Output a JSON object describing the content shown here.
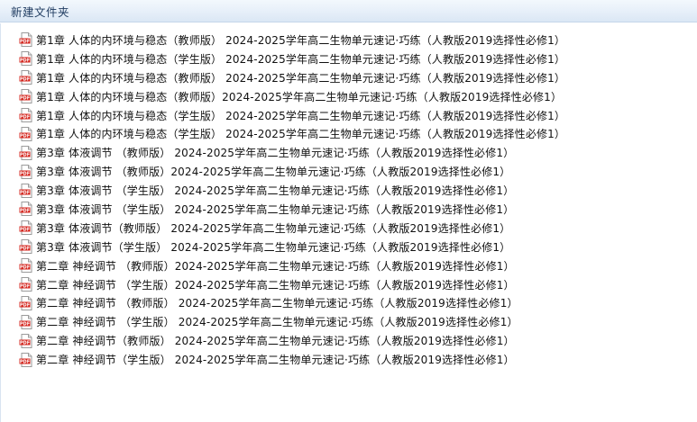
{
  "window": {
    "title": "新建文件夹"
  },
  "files": [
    {
      "name": "第1章 人体的内环境与稳态（教师版） 2024-2025学年高二生物单元速记·巧练（人教版2019选择性必修1）",
      "icon": "pdf-icon"
    },
    {
      "name": "第1章 人体的内环境与稳态（学生版） 2024-2025学年高二生物单元速记·巧练（人教版2019选择性必修1）",
      "icon": "pdf-icon"
    },
    {
      "name": "第1章 人体的内环境与稳态（教师版） 2024-2025学年高二生物单元速记·巧练（人教版2019选择性必修1）",
      "icon": "pdf-icon"
    },
    {
      "name": "第1章 人体的内环境与稳态（教师版）2024-2025学年高二生物单元速记·巧练（人教版2019选择性必修1）",
      "icon": "pdf-icon"
    },
    {
      "name": "第1章 人体的内环境与稳态（学生版） 2024-2025学年高二生物单元速记·巧练（人教版2019选择性必修1）",
      "icon": "pdf-icon"
    },
    {
      "name": "第1章 人体的内环境与稳态（学生版） 2024-2025学年高二生物单元速记·巧练（人教版2019选择性必修1）",
      "icon": "pdf-icon"
    },
    {
      "name": "第3章 体液调节 （教师版） 2024-2025学年高二生物单元速记·巧练（人教版2019选择性必修1）",
      "icon": "pdf-icon"
    },
    {
      "name": "第3章 体液调节 （教师版）2024-2025学年高二生物单元速记·巧练（人教版2019选择性必修1）",
      "icon": "pdf-icon"
    },
    {
      "name": "第3章 体液调节 （学生版） 2024-2025学年高二生物单元速记·巧练（人教版2019选择性必修1）",
      "icon": "pdf-icon"
    },
    {
      "name": "第3章 体液调节 （学生版） 2024-2025学年高二生物单元速记·巧练（人教版2019选择性必修1）",
      "icon": "pdf-icon"
    },
    {
      "name": "第3章 体液调节（教师版） 2024-2025学年高二生物单元速记·巧练（人教版2019选择性必修1）",
      "icon": "pdf-icon"
    },
    {
      "name": "第3章 体液调节（学生版） 2024-2025学年高二生物单元速记·巧练（人教版2019选择性必修1）",
      "icon": "pdf-icon"
    },
    {
      "name": "第二章  神经调节 （教师版）2024-2025学年高二生物单元速记·巧练（人教版2019选择性必修1）",
      "icon": "pdf-icon"
    },
    {
      "name": "第二章  神经调节 （学生版）2024-2025学年高二生物单元速记·巧练（人教版2019选择性必修1）",
      "icon": "pdf-icon"
    },
    {
      "name": "第二章 神经调节 （教师版） 2024-2025学年高二生物单元速记·巧练（人教版2019选择性必修1）",
      "icon": "pdf-icon"
    },
    {
      "name": "第二章 神经调节 （学生版） 2024-2025学年高二生物单元速记·巧练（人教版2019选择性必修1）",
      "icon": "pdf-icon"
    },
    {
      "name": "第二章 神经调节（教师版） 2024-2025学年高二生物单元速记·巧练（人教版2019选择性必修1）",
      "icon": "pdf-icon"
    },
    {
      "name": "第二章 神经调节（学生版） 2024-2025学年高二生物单元速记·巧练（人教版2019选择性必修1）",
      "icon": "pdf-icon"
    }
  ],
  "colors": {
    "titlebar_text": "#1e3a5f",
    "pdf_red": "#d4231b",
    "file_text": "#111111"
  }
}
